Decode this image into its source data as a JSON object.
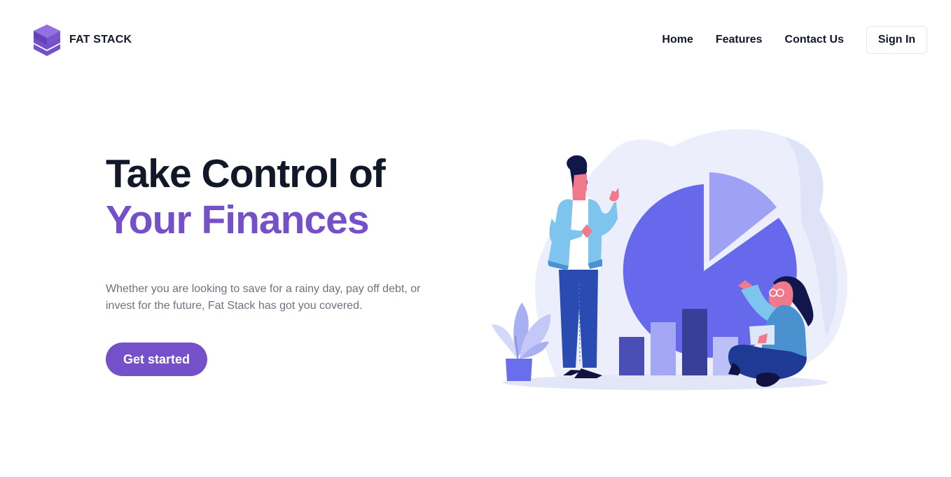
{
  "brand": {
    "name": "FAT STACK",
    "icon": "stacked-layers-icon",
    "accent_color": "#7450c9"
  },
  "nav": {
    "links": [
      "Home",
      "Features",
      "Contact Us"
    ],
    "sign_in": "Sign In"
  },
  "hero": {
    "title_line1": "Take Control of",
    "title_line2": "Your Finances",
    "description": "Whether you are looking to save for a rainy day, pay off debt, or invest for the future, Fat Stack has got you covered.",
    "cta": "Get started"
  },
  "illustration": {
    "subject": "finance-team-illustration"
  }
}
